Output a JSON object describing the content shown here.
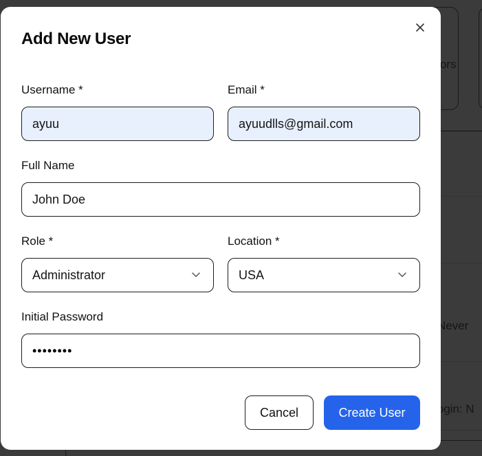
{
  "background": {
    "card_text": "rators",
    "row_text_1": "Never",
    "row_text_2": "login: N"
  },
  "modal": {
    "title": "Add New User",
    "close_icon": "close-icon",
    "fields": {
      "username": {
        "label": "Username *",
        "value": "ayuu"
      },
      "email": {
        "label": "Email *",
        "value": "ayuudlls@gmail.com"
      },
      "full_name": {
        "label": "Full Name",
        "value": "John Doe"
      },
      "role": {
        "label": "Role *",
        "value": "Administrator"
      },
      "location": {
        "label": "Location *",
        "value": "USA"
      },
      "password": {
        "label": "Initial Password",
        "value": "••••••••"
      }
    },
    "buttons": {
      "cancel": "Cancel",
      "create": "Create User"
    }
  },
  "colors": {
    "primary": "#2563eb",
    "autofill_bg": "#e8f0fe",
    "overlay": "#3b3b3b"
  }
}
